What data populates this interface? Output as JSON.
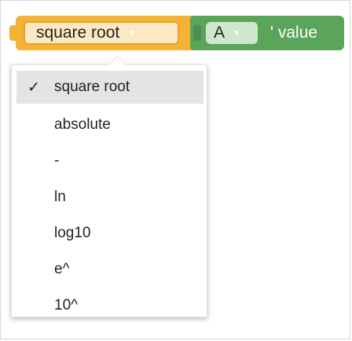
{
  "math_block": {
    "selected_operation": "square root",
    "colors": {
      "block": "#f5b335",
      "field": "#fde8c4"
    }
  },
  "variable_block": {
    "variable_name": "A",
    "label": "' value",
    "colors": {
      "block": "#5ba55b",
      "field": "#cfe7cf"
    }
  },
  "dropdown_menu": {
    "check_mark": "✓",
    "items": [
      {
        "label": "square root",
        "selected": true
      },
      {
        "label": "absolute",
        "selected": false
      },
      {
        "label": "-",
        "selected": false
      },
      {
        "label": "ln",
        "selected": false
      },
      {
        "label": "log10",
        "selected": false
      },
      {
        "label": "e^",
        "selected": false
      },
      {
        "label": "10^",
        "selected": false
      }
    ]
  }
}
